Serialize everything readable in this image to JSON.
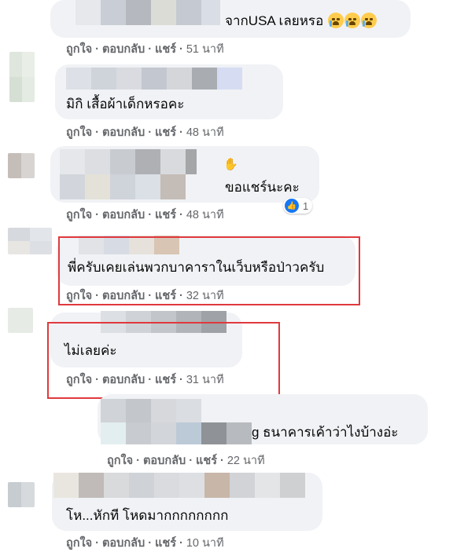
{
  "actions": {
    "like": "ถูกใจ",
    "reply": "ตอบกลับ",
    "share": "แชร์",
    "sep": "·"
  },
  "colors": {
    "bubble": "#f0f2f5",
    "highlight": "#e0393e",
    "meta": "#65676b",
    "like": "#1877f2"
  },
  "comments": [
    {
      "text": "จากUSA เลยหรอ",
      "emoji": "loudly-crying-face",
      "emoji_count": 3,
      "time": "51 นาที"
    },
    {
      "text": "มิกิ เสื้อผ้าเด็กหรอคะ",
      "time": "48 นาที"
    },
    {
      "text": "ขอแชร์นะคะ",
      "reaction_icon": "like-icon",
      "reaction_count": "1",
      "time": "48 นาที"
    },
    {
      "text": "พี่ครับเคยเล่นพวกบาคาราในเว็บหรือป่าวครับ",
      "time": "32 นาที",
      "highlighted": true
    },
    {
      "text": "ไม่เลยค่ะ",
      "time": "31 นาที",
      "highlighted": true
    },
    {
      "text_visible": "g ธนาคารเค้าว่าไงบ้างอ่ะ",
      "time": "22 นาที"
    },
    {
      "text": "โห...หักที โหดมากกกกกกกก",
      "time": "10 นาที"
    }
  ]
}
